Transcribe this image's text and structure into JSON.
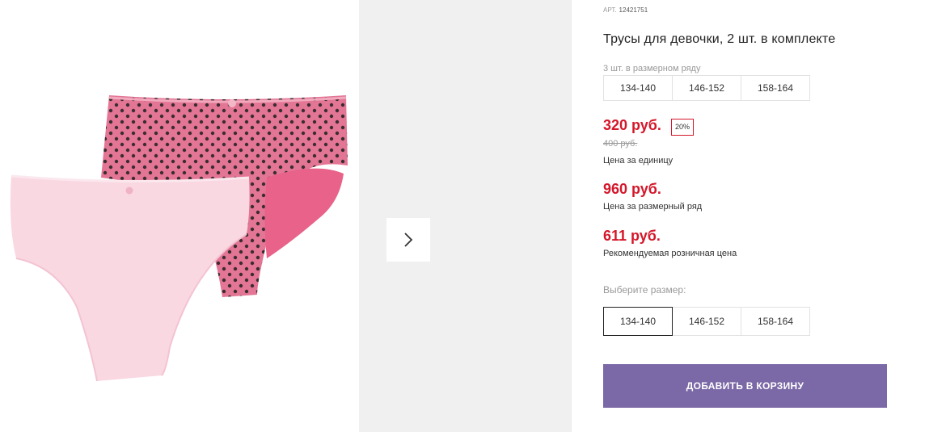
{
  "product": {
    "art_label": "АРТ.",
    "art_value": "12421751",
    "title": "Трусы для девочки, 2 шт. в комплекте",
    "image_alt": "product-photo-pink-panties",
    "size_range_label": "3 шт. в размерном ряду",
    "size_range": [
      "134-140",
      "146-152",
      "158-164"
    ],
    "price": "320 руб.",
    "discount": "20%",
    "old_price": "400 руб.",
    "price_caption": "Цена за единицу",
    "range_price": "960 руб.",
    "range_price_caption": "Цена за размерный ряд",
    "rrp_price": "611 руб.",
    "rrp_caption": "Рекомендуемая розничная цена",
    "choose_size_label": "Выберите размер:",
    "sizes": [
      "134-140",
      "146-152",
      "158-164"
    ],
    "selected_size": "134-140",
    "add_to_cart": "ДОБАВИТЬ В КОРЗИНУ"
  },
  "colors": {
    "price_red": "#d4172a",
    "button_purple": "#7b68a6",
    "gallery_bg": "#f0f0f0",
    "dark_pink": "#e37595",
    "light_pink": "#f9d8e2"
  },
  "icons": {
    "next": "chevron-right-icon"
  }
}
